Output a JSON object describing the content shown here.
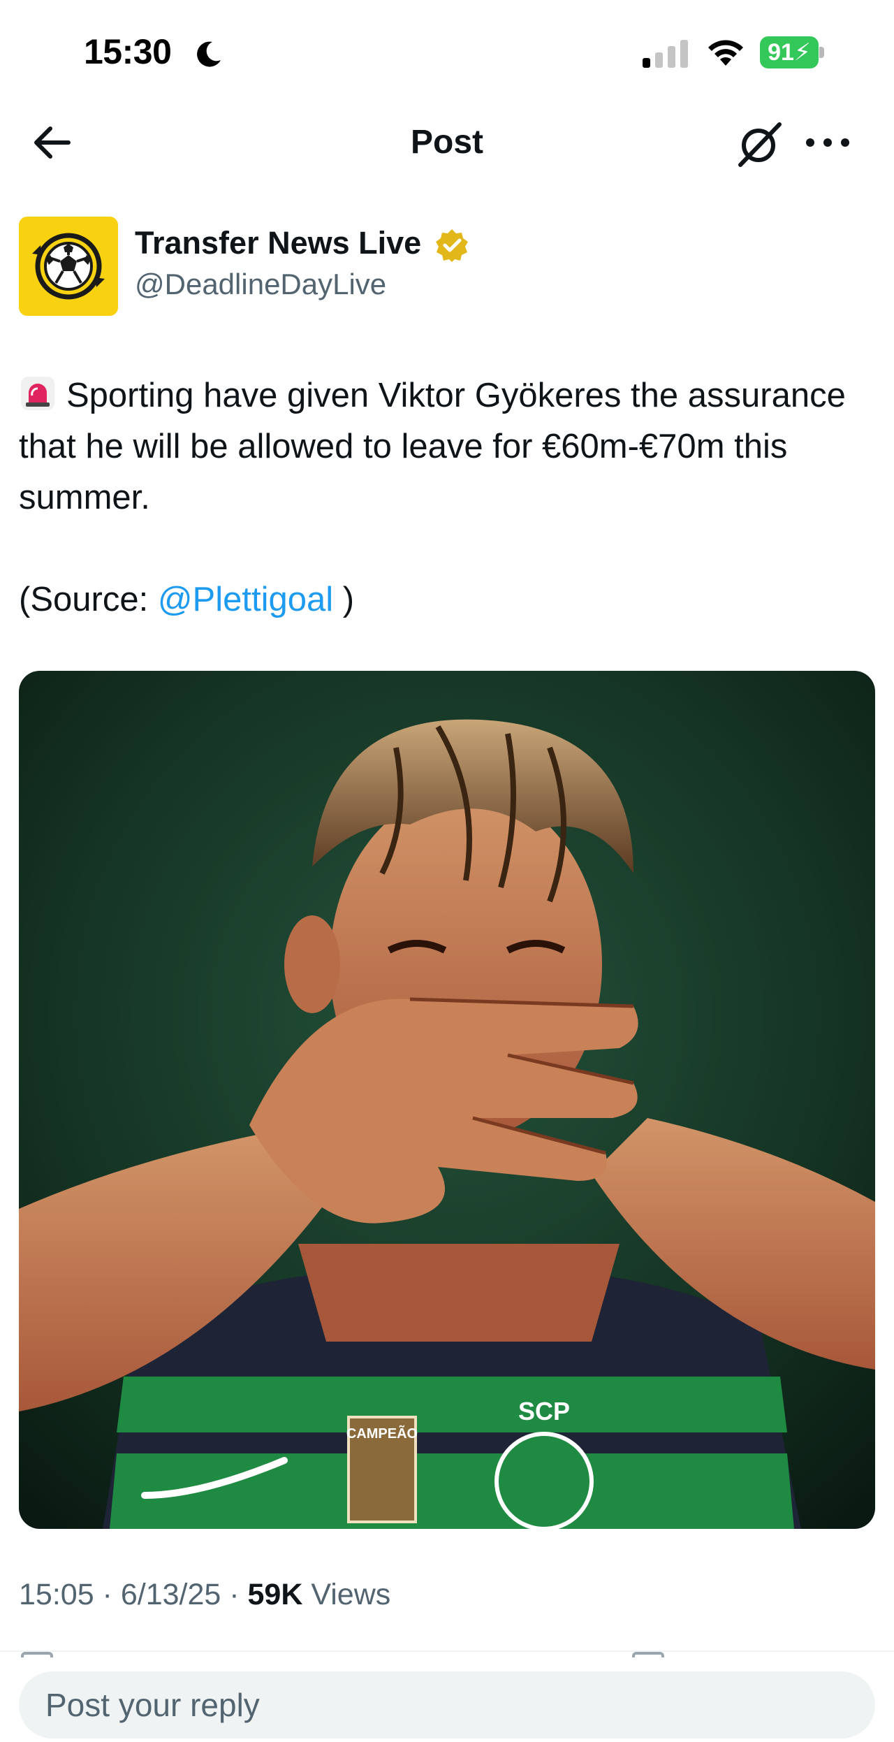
{
  "status_bar": {
    "time": "15:30",
    "battery_level": "91",
    "icons": [
      "moon-icon",
      "signal-icon",
      "wifi-icon",
      "battery-icon"
    ]
  },
  "nav": {
    "title": "Post",
    "icons": [
      "back-arrow-icon",
      "grok-icon",
      "more-icon"
    ]
  },
  "post": {
    "author": {
      "name": "Transfer News Live",
      "handle": "@DeadlineDayLive",
      "verified": true,
      "avatar_icon": "soccer-ball-transfer-icon"
    },
    "text": {
      "emoji": "siren-icon",
      "body": "Sporting have given Viktor Gyökeres the assurance that he will be allowed to leave for €60m-€70m this summer.",
      "source_prefix": "(Source: ",
      "source_mention": "@Plettigoal",
      "source_suffix": " )"
    },
    "image": {
      "description_icon": "player-photo",
      "badge_text": "CAMPEÃO",
      "crest_text": "SCP"
    },
    "meta": {
      "time": "15:05",
      "separator": " · ",
      "date": "6/13/25",
      "views_count": "59K",
      "views_label": " Views"
    }
  },
  "reply": {
    "placeholder": "Post your reply"
  },
  "colors": {
    "accent": "#1d9bf0",
    "text": "#0f1419",
    "muted": "#536471",
    "avatar_bg": "#f8d210",
    "battery": "#34c759",
    "verified": "#e2b719"
  }
}
